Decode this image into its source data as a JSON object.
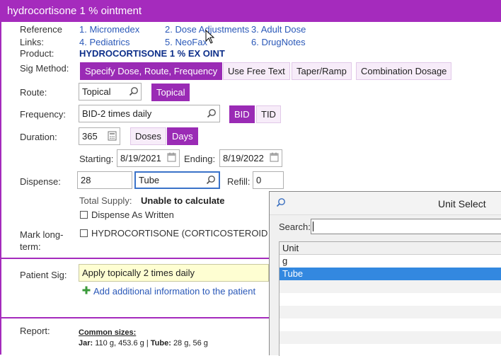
{
  "window": {
    "title": "hydrocortisone 1 % ointment"
  },
  "reference": {
    "label_line1": "Reference",
    "label_line2": "Links:",
    "links": [
      "1. Micromedex",
      "2. Dose Adjustments",
      "3. Adult Dose",
      "4. Pediatrics",
      "5. NeoFax",
      "6. DrugNotes"
    ]
  },
  "product": {
    "label": "Product:",
    "value": "HYDROCORTISONE 1 % EX OINT"
  },
  "sig_method": {
    "label": "Sig Method:",
    "options": [
      "Specify Dose, Route, Frequency",
      "Use Free Text",
      "Taper/Ramp",
      "Combination Dosage"
    ],
    "selected": "Specify Dose, Route, Frequency"
  },
  "route": {
    "label": "Route:",
    "value": "Topical",
    "quick_button": "Topical"
  },
  "frequency": {
    "label": "Frequency:",
    "value": "BID-2 times daily",
    "quick_buttons": [
      "BID",
      "TID"
    ],
    "selected": "BID"
  },
  "duration": {
    "label": "Duration:",
    "value": "365",
    "units": [
      "Doses",
      "Days"
    ],
    "selected": "Days"
  },
  "dates": {
    "starting_label": "Starting:",
    "starting_value": "8/19/2021",
    "ending_label": "Ending:",
    "ending_value": "8/19/2022"
  },
  "dispense": {
    "label": "Dispense:",
    "quantity": "28",
    "unit": "Tube",
    "refill_label": "Refill:",
    "refill_value": "0"
  },
  "total_supply": {
    "label": "Total Supply:",
    "value": "Unable to calculate"
  },
  "dispense_as_written": {
    "label": "Dispense As Written",
    "checked": false
  },
  "mark_long_term": {
    "label_line1": "Mark long-",
    "label_line2": "term:",
    "option": "HYDROCORTISONE (CORTICOSTEROIDS -",
    "checked": false
  },
  "patient_sig": {
    "label": "Patient Sig:",
    "value": "Apply topically 2 times daily",
    "add_info": "Add additional information to the patient"
  },
  "report": {
    "label": "Report:",
    "heading": "Common sizes:",
    "jar_label": "Jar:",
    "jar_sizes": "110 g, 453.6 g |",
    "tube_label": "Tube:",
    "tube_sizes": "28 g, 56 g"
  },
  "unit_select": {
    "title": "Unit Select",
    "search_label": "Search:",
    "search_value": "",
    "column": "Unit",
    "rows": [
      "g",
      "Tube"
    ],
    "selected": "Tube"
  }
}
